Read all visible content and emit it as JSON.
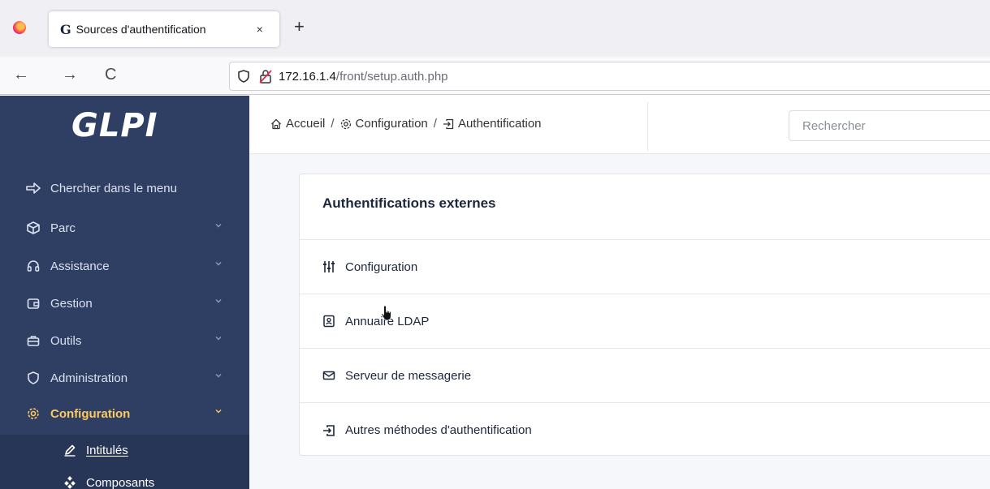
{
  "browser": {
    "tab_title": "Sources d'authentification",
    "tab_favicon": "G",
    "tab_close": "×",
    "new_tab": "+",
    "back": "←",
    "forward": "→",
    "reload": "C",
    "url_host": "172.16.1.4",
    "url_path": "/front/setup.auth.php"
  },
  "sidebar": {
    "logo": "GLPI",
    "items": [
      {
        "label": "Chercher dans le menu",
        "icon": "arrow-right-icon"
      },
      {
        "label": "Parc",
        "icon": "box-icon"
      },
      {
        "label": "Assistance",
        "icon": "headset-icon"
      },
      {
        "label": "Gestion",
        "icon": "wallet-icon"
      },
      {
        "label": "Outils",
        "icon": "briefcase-icon"
      },
      {
        "label": "Administration",
        "icon": "shield-icon"
      },
      {
        "label": "Configuration",
        "icon": "gear-icon"
      }
    ],
    "submenu": [
      {
        "label": "Intitulés",
        "icon": "edit-icon"
      },
      {
        "label": "Composants",
        "icon": "components-icon"
      }
    ]
  },
  "breadcrumb": {
    "home": "Accueil",
    "section": "Configuration",
    "page": "Authentification",
    "separator": "/"
  },
  "search": {
    "placeholder": "Rechercher"
  },
  "card": {
    "title": "Authentifications externes",
    "rows": [
      {
        "label": "Configuration",
        "icon": "sliders-icon"
      },
      {
        "label": "Annuaire LDAP",
        "icon": "address-book-icon"
      },
      {
        "label": "Serveur de messagerie",
        "icon": "mail-icon"
      },
      {
        "label": "Autres méthodes d'authentification",
        "icon": "login-icon"
      }
    ]
  },
  "colors": {
    "sidebar_bg": "#2f3f64",
    "submenu_bg": "#273556",
    "active_accent": "#fec95c",
    "main_bg": "#f5f7fb"
  }
}
